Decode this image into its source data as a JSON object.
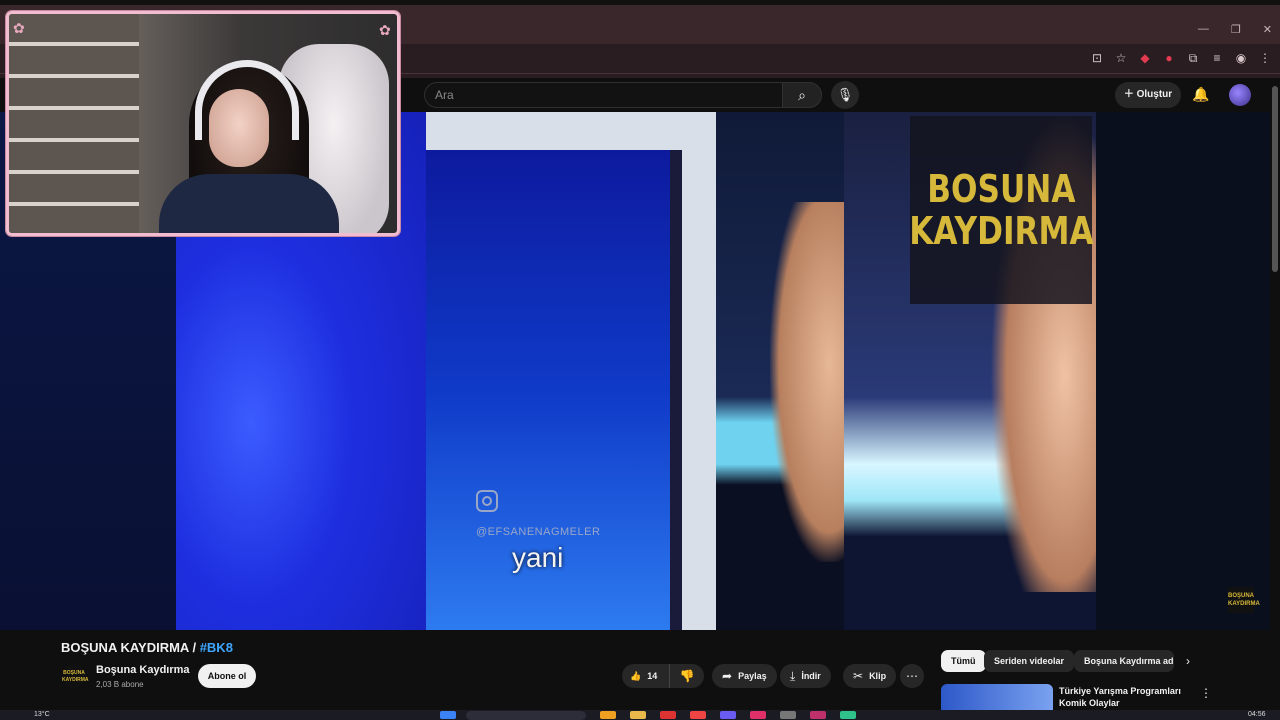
{
  "browser": {
    "window_controls": [
      "—",
      "❐",
      "✕"
    ],
    "extension_icons": [
      "install-icon",
      "star-icon",
      "extension-red-icon",
      "extension-red2-icon",
      "puzzle-icon",
      "playlist-icon",
      "profile-icon",
      "menu-icon"
    ]
  },
  "header": {
    "search_placeholder": "Ara",
    "create_label": "Oluştur"
  },
  "video": {
    "logo_line1": "BOSUNA",
    "logo_line2": "KAYDIRMA",
    "handle": "@EFSANENAGMELER",
    "subtitle": "yani",
    "mini_logo": "BOŞUNA KAYDIRMA"
  },
  "details": {
    "title": "BOŞUNA KAYDIRMA / ",
    "hashtag": "#BK8",
    "channel_name": "Boşuna Kaydırma",
    "subscribers": "2,03 B abone",
    "subscribe_label": "Abone ol",
    "like_count": "14",
    "share_label": "Paylaş",
    "download_label": "İndir",
    "clip_label": "Klip"
  },
  "sidebar": {
    "chips": [
      "Tümü",
      "Seriden videolar",
      "Boşuna Kaydırma adl"
    ],
    "recommendation_title": "Türkiye Yarışma Programları Komik Olaylar"
  },
  "taskbar": {
    "temperature": "13°C",
    "time": "04:56"
  }
}
